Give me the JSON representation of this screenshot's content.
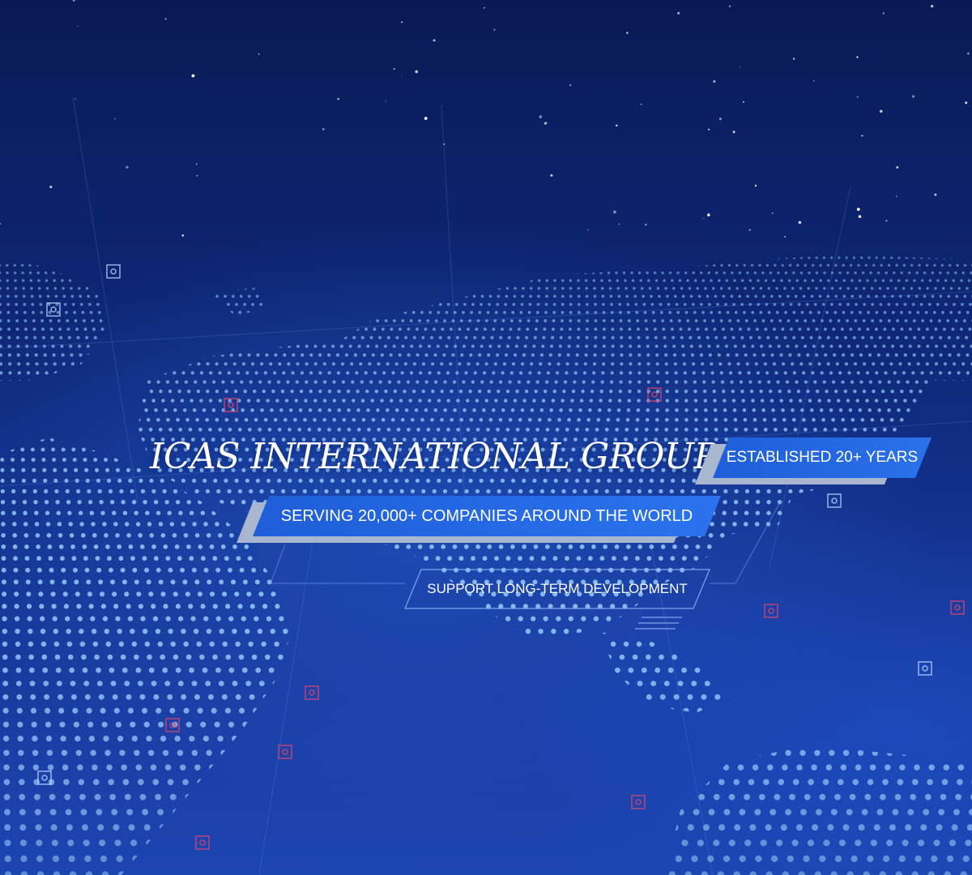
{
  "hero": {
    "title": "ICAS INTERNATIONAL GROUP",
    "badges": {
      "established": "ESTABLISHED 20+ YEARS",
      "serving": "SERVING 20,000+ COMPANIES AROUND THE WORLD",
      "support": "SUPPORT LONG-TERM DEVELOPMENT"
    }
  },
  "colors": {
    "background_top": "#0a1a55",
    "background_bottom": "#1d45b0",
    "badge_fill": "#2366e0",
    "badge_shadow": "#a9b6cf",
    "text": "#ffffff",
    "map_dots": "#9fd4ff",
    "marker_red": "#e0466a"
  },
  "icons": [
    "world-map-dots",
    "stars",
    "target-markers"
  ]
}
